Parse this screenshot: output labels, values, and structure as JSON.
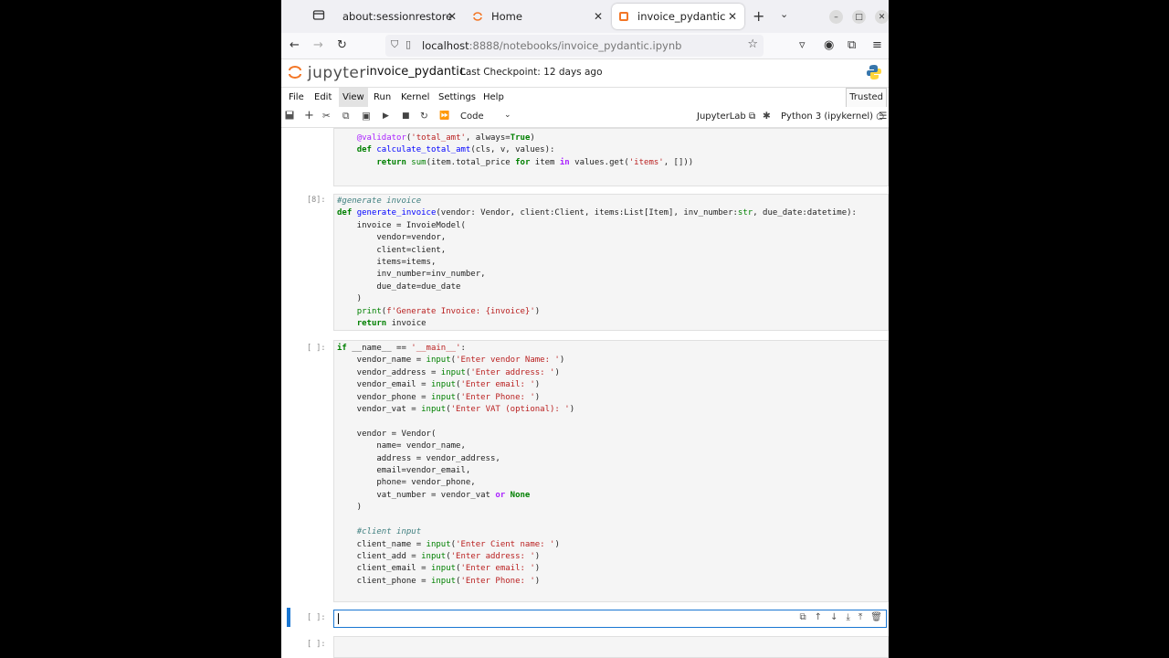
{
  "browser": {
    "tabs": [
      {
        "title": "about:sessionrestore",
        "icon": "history-icon"
      },
      {
        "title": "Home",
        "icon": "jupyter-icon"
      },
      {
        "title": "invoice_pydantic",
        "icon": "jupyter-icon",
        "active": true
      }
    ],
    "url_host": "localhost",
    "url_rest": ":8888/notebooks/invoice_pydantic.ipynb"
  },
  "jupyter": {
    "logo_text": "jupyter",
    "notebook_title": "invoice_pydantic",
    "checkpoint": "Last Checkpoint: 12 days ago",
    "menu": [
      "File",
      "Edit",
      "View",
      "Run",
      "Kernel",
      "Settings",
      "Help"
    ],
    "selected_menu": "View",
    "trusted": "Trusted",
    "cell_type": "Code",
    "jupyterlab_link": "JupyterLab",
    "kernel": "Python 3 (ipykernel)"
  },
  "cells": [
    {
      "prompt": ""
    },
    {
      "prompt": "[8]:"
    },
    {
      "prompt": "[ ]:"
    },
    {
      "prompt": "[ ]:"
    },
    {
      "prompt": "[ ]:"
    }
  ],
  "colors": {
    "accent": "#1976d2",
    "keyword": "#008000",
    "string": "#ba2121",
    "comment": "#408080"
  }
}
